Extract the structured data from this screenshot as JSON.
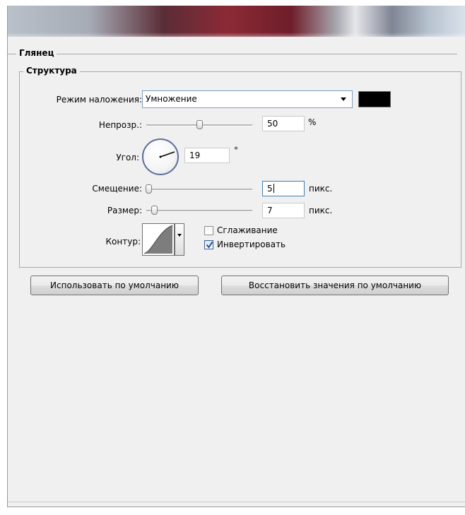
{
  "section_title": "Глянец",
  "group_title": "Структура",
  "blend_mode": {
    "label": "Режим наложения:",
    "value": "Умножение",
    "color": "#000000"
  },
  "opacity": {
    "label": "Непрозр.:",
    "value": "50",
    "unit": "%",
    "slider_fraction": 0.5
  },
  "angle": {
    "label": "Угол:",
    "value": "19",
    "unit": "°"
  },
  "distance": {
    "label": "Смещение:",
    "value": "5",
    "unit": "пикс.",
    "slider_fraction": 0.02
  },
  "size": {
    "label": "Размер:",
    "value": "7",
    "unit": "пикс.",
    "slider_fraction": 0.05
  },
  "contour": {
    "label": "Контур:",
    "anti_alias": {
      "label": "Сглаживание",
      "checked": false
    },
    "invert": {
      "label": "Инвертировать",
      "checked": true
    }
  },
  "buttons": {
    "make_default": "Использовать по умолчанию",
    "reset_default": "Восстановить значения по умолчанию"
  }
}
